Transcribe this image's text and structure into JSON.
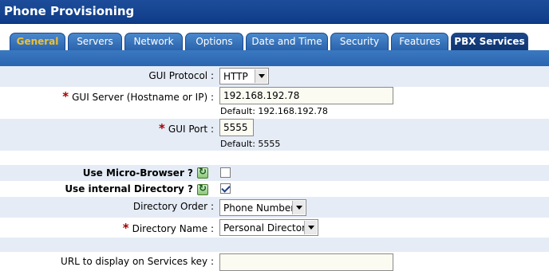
{
  "app": {
    "title": "Phone Provisioning"
  },
  "tabs": [
    {
      "label": "General",
      "active": true
    },
    {
      "label": "Servers",
      "active": false
    },
    {
      "label": "Network",
      "active": false
    },
    {
      "label": "Options",
      "active": false
    },
    {
      "label": "Date and Time",
      "active": false
    },
    {
      "label": "Security",
      "active": false
    },
    {
      "label": "Features",
      "active": false
    },
    {
      "label": "PBX Services",
      "active": false
    }
  ],
  "form": {
    "gui_protocol": {
      "label": "GUI Protocol",
      "value": "HTTP"
    },
    "gui_server": {
      "label": "GUI Server (Hostname or IP)",
      "value": "192.168.192.78",
      "default_text": "Default: 192.168.192.78",
      "required": true
    },
    "gui_port": {
      "label": "GUI Port",
      "value": "5555",
      "default_text": "Default: 5555",
      "required": true
    },
    "use_micro_browser": {
      "label": "Use Micro-Browser ?",
      "checked": false
    },
    "use_internal_directory": {
      "label": "Use internal Directory ?",
      "checked": true
    },
    "directory_order": {
      "label": "Directory Order",
      "value": "Phone Number"
    },
    "directory_name": {
      "label": "Directory Name",
      "value": "Personal Directory",
      "required": true
    },
    "services_url": {
      "label": "URL to display on Services key",
      "value": ""
    },
    "required_marker": "*",
    "label_separator": ":"
  },
  "colors": {
    "title_bar": "#0f3c88",
    "tab_active_text": "#f0c030",
    "row_shade": "#e5ecf6",
    "required": "#a00000"
  }
}
